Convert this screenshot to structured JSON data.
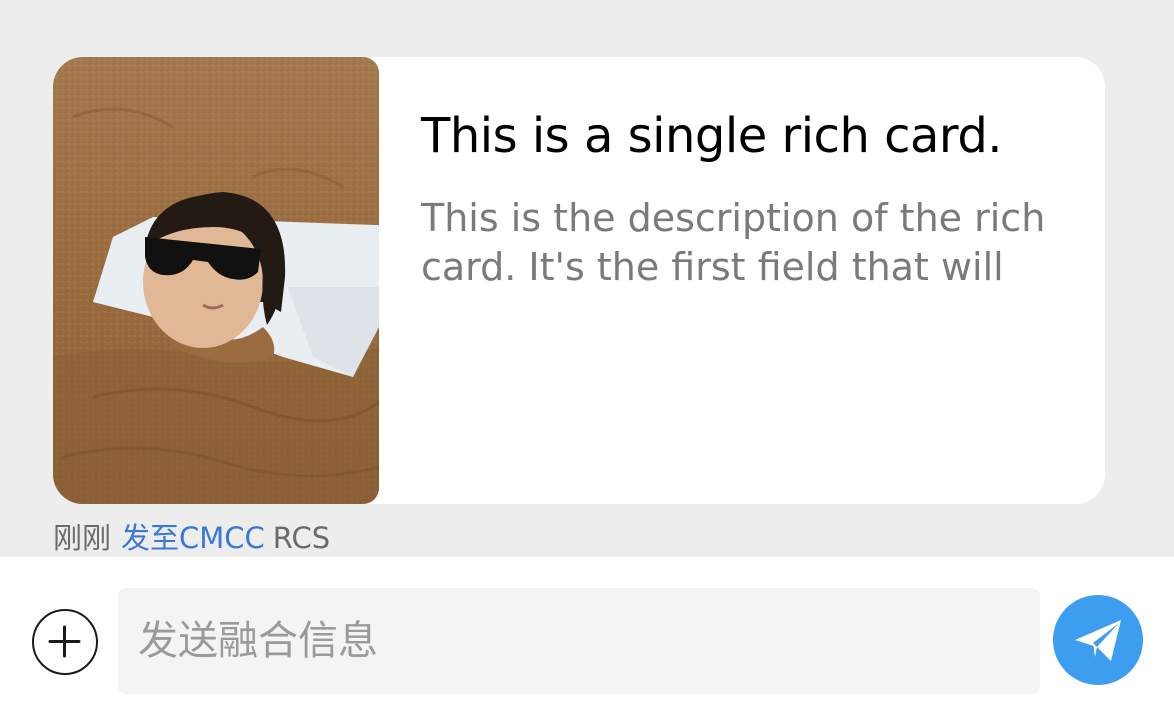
{
  "rich_card": {
    "title": "This is a single rich card.",
    "description": "This is the description of the rich card. It's the first field that will",
    "media_icon": "photo-child-buried-in-sand"
  },
  "message_meta": {
    "time": "刚刚",
    "destination": "发至CMCC",
    "channel": "RCS"
  },
  "composer": {
    "placeholder": "发送融合信息",
    "add_icon": "plus-circle-icon",
    "send_icon": "paper-plane-icon"
  },
  "colors": {
    "background": "#ededed",
    "card": "#ffffff",
    "accent_link": "#3a78d6",
    "send_button": "#3d9ef0"
  }
}
